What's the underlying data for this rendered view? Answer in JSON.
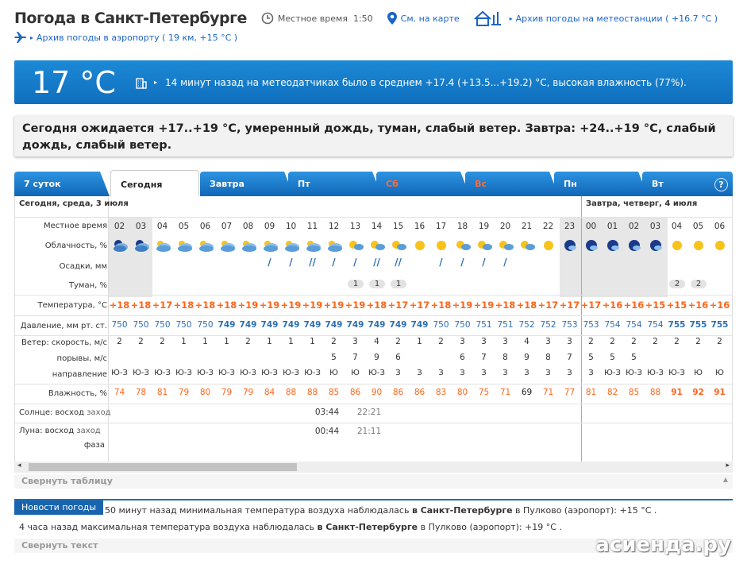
{
  "header": {
    "title": "Погода в Санкт-Петербурге",
    "local_time_label": "Местное время",
    "local_time": "1:50",
    "map_link": "См. на карте",
    "archive_station": "Архив погоды на метеостанции",
    "archive_station_temp": "( +16.7 °C )",
    "archive_airport": "Архив погоды в аэропорту",
    "archive_airport_info": "( 19 км, +15 °C )"
  },
  "current": {
    "temp": "17 °C",
    "meteo": "14 минут назад на метеодатчиках было в среднем +17.4 (+13.5...+19.2) °C, высокая влажность (77%)."
  },
  "forecast_text": "Сегодня ожидается +17..+19 °C, умеренный дождь, туман, слабый ветер. Завтра: +24..+19 °C, слабый дождь, слабый ветер.",
  "tabs": [
    {
      "label": "7 суток"
    },
    {
      "label": "Сегодня"
    },
    {
      "label": "Завтра"
    },
    {
      "label": "Пт"
    },
    {
      "label": "Сб"
    },
    {
      "label": "Вс"
    },
    {
      "label": "Пн"
    },
    {
      "label": "Вт"
    }
  ],
  "help": "?",
  "dates": {
    "today": "Сегодня, среда, 3 июля",
    "tomorrow": "Завтра, четверг, 4 июля"
  },
  "row_labels": {
    "time": "Местное время",
    "cloud": "Облачность, %",
    "precip": "Осадки, мм",
    "fog": "Туман, %",
    "temp": "Температура, °C",
    "pressure": "Давление, мм рт. ст.",
    "wind": "Ветер: скорость, м/с",
    "gusts": "порывы, м/с",
    "dir": "направление",
    "hum": "Влажность, %",
    "sun": "Солнце:",
    "sun_rise": "восход",
    "sun_set": "заход",
    "moon": "Луна:",
    "moon_rise": "восход",
    "moon_set": "заход",
    "phase": "фаза"
  },
  "hours": [
    "02",
    "03",
    "04",
    "05",
    "06",
    "07",
    "08",
    "09",
    "10",
    "11",
    "12",
    "13",
    "14",
    "15",
    "16",
    "17",
    "18",
    "19",
    "20",
    "21",
    "22",
    "23",
    "00",
    "01",
    "02",
    "03",
    "04",
    "05",
    "06"
  ],
  "cloud_icons": [
    "night-heavy-cloud",
    "night-heavy-cloud",
    "day-cloud",
    "day-cloud",
    "day-cloud",
    "day-cloud",
    "day-cloud",
    "day-cloud",
    "day-cloud",
    "day-cloud",
    "day-cloud",
    "partly-cloudy",
    "partly-cloudy",
    "partly-cloudy",
    "sun",
    "sun",
    "partly-cloudy",
    "partly-cloudy",
    "partly-cloudy",
    "partly-cloudy",
    "sun",
    "night-cloud",
    "night-cloud",
    "night-cloud",
    "night-cloud",
    "night-cloud",
    "sun",
    "sun",
    "sun"
  ],
  "precip": [
    0,
    0,
    0,
    0,
    0,
    0,
    0,
    1,
    1,
    2,
    1,
    1,
    2,
    2,
    0,
    1,
    1,
    1,
    1,
    0,
    0,
    0,
    0,
    0,
    0,
    0,
    0,
    0,
    0
  ],
  "fog": [
    "",
    "",
    "",
    "",
    "",
    "",
    "",
    "",
    "",
    "",
    "",
    "1",
    "1",
    "1",
    "",
    "",
    "",
    "",
    "",
    "",
    "",
    "",
    "",
    "",
    "",
    "",
    "2",
    "2",
    ""
  ],
  "temps": [
    "+18",
    "+18",
    "+17",
    "+18",
    "+18",
    "+18",
    "+19",
    "+19",
    "+19",
    "+19",
    "+19",
    "+19",
    "+18",
    "+17",
    "+17",
    "+18",
    "+19",
    "+19",
    "+18",
    "+18",
    "+17",
    "+17",
    "+17",
    "+16",
    "+16",
    "+15",
    "+15",
    "+16",
    "+16"
  ],
  "pressure": [
    "750",
    "750",
    "750",
    "750",
    "750",
    "749",
    "749",
    "749",
    "749",
    "749",
    "749",
    "749",
    "749",
    "749",
    "749",
    "750",
    "750",
    "751",
    "751",
    "752",
    "752",
    "753",
    "753",
    "754",
    "754",
    "754",
    "755",
    "755",
    "755"
  ],
  "wind": [
    "2",
    "2",
    "2",
    "1",
    "1",
    "1",
    "2",
    "1",
    "1",
    "1",
    "2",
    "3",
    "4",
    "2",
    "1",
    "2",
    "3",
    "3",
    "3",
    "4",
    "3",
    "3",
    "2",
    "2",
    "2",
    "2",
    "2",
    "2",
    "2"
  ],
  "gusts": [
    "",
    "",
    "",
    "",
    "",
    "",
    "",
    "",
    "",
    "",
    "5",
    "7",
    "9",
    "6",
    "",
    "",
    "6",
    "7",
    "8",
    "9",
    "8",
    "7",
    "5",
    "5",
    "5",
    "",
    "",
    "",
    ""
  ],
  "dir": [
    "Ю-З",
    "Ю-З",
    "Ю-З",
    "Ю-З",
    "Ю-З",
    "Ю-З",
    "Ю-З",
    "Ю-З",
    "Ю-З",
    "Ю-З",
    "Ю",
    "Ю",
    "Ю-З",
    "З",
    "З",
    "З",
    "З",
    "З",
    "З",
    "З",
    "З",
    "З",
    "З",
    "Ю-З",
    "Ю-З",
    "Ю-З",
    "Ю-З",
    "Ю",
    "Ю"
  ],
  "humidity": [
    "74",
    "78",
    "81",
    "79",
    "80",
    "79",
    "79",
    "84",
    "88",
    "88",
    "85",
    "86",
    "90",
    "86",
    "86",
    "83",
    "80",
    "75",
    "71",
    "69",
    "71",
    "77",
    "81",
    "82",
    "85",
    "88",
    "91",
    "92",
    "91"
  ],
  "sun": {
    "rise": "03:44",
    "set": "22:21"
  },
  "moon": {
    "rise": "00:44",
    "set": "21:11"
  },
  "collapse_table": "Свернуть таблицу",
  "news": {
    "tag": "Новости погоды",
    "line1_a": "50 минут назад минимальная температура воздуха наблюдалась",
    "line1_b": "в Санкт-Петербурге",
    "line1_c": "в Пулково (аэропорт): +15 °C .",
    "line2_a": "4 часа назад максимальная температура воздуха наблюдалась",
    "line2_b": "в Санкт-Петербурге",
    "line2_c": "в Пулково (аэропорт): +19 °C ."
  },
  "collapse_text": "Свернуть текст",
  "watermark": "асиенда.ру"
}
